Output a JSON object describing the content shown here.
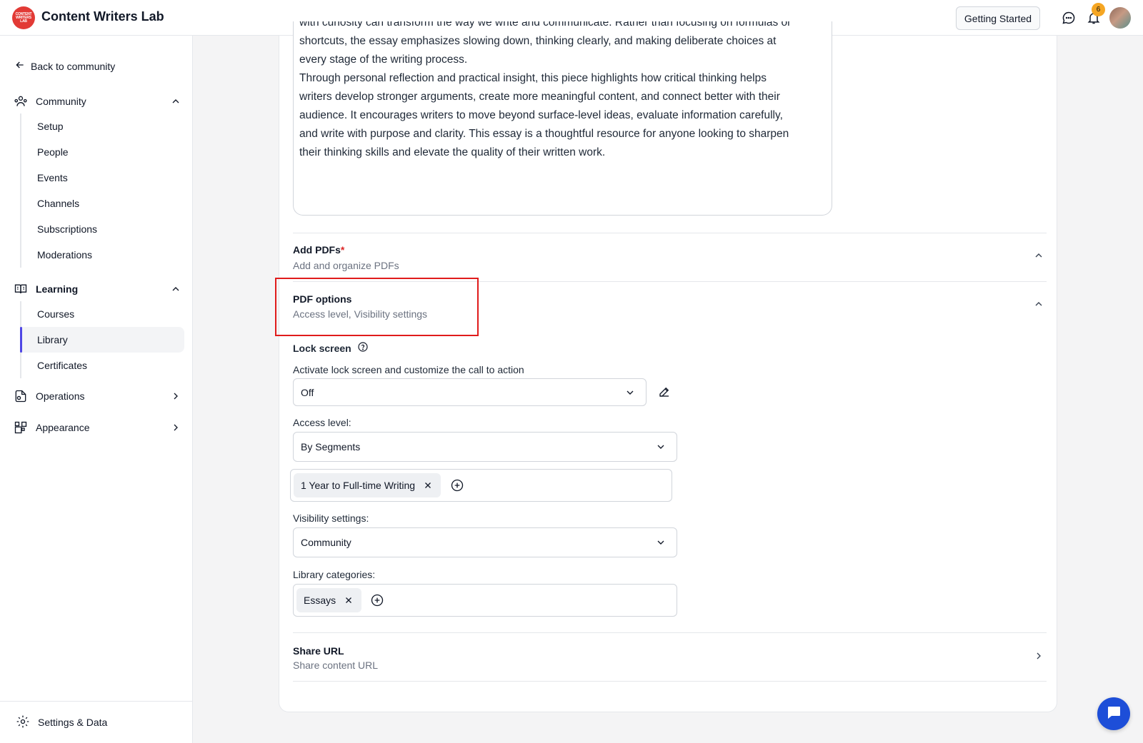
{
  "app": {
    "title": "Content Writers Lab",
    "logo_text": "CONTENT WRITERS LAB"
  },
  "topbar": {
    "getting_started_label": "Getting Started",
    "notification_count": "6"
  },
  "sidebar": {
    "back_label": "Back to community",
    "community": {
      "label": "Community",
      "items": [
        "Setup",
        "People",
        "Events",
        "Channels",
        "Subscriptions",
        "Moderations"
      ]
    },
    "learning": {
      "label": "Learning",
      "items": [
        "Courses",
        "Library",
        "Certificates"
      ],
      "active_item": "Library"
    },
    "operations_label": "Operations",
    "appearance_label": "Appearance",
    "settings_label": "Settings & Data"
  },
  "description": {
    "partial_line": "with curiosity can transform the way we write and communicate. Rather than focusing on formulas or",
    "line_2": "shortcuts, the essay emphasizes slowing down, thinking clearly, and making deliberate choices at",
    "line_3": "every stage of the writing process.",
    "paragraph_2_l1": "Through personal reflection and practical insight, this piece highlights how critical thinking helps",
    "paragraph_2_l2": "writers develop stronger arguments, create more meaningful content, and connect better with their",
    "paragraph_2_l3": "audience. It encourages writers to move beyond surface-level ideas, evaluate information carefully,",
    "paragraph_2_l4": "and write with purpose and clarity. This essay is a thoughtful resource for anyone looking to sharpen",
    "paragraph_2_l5": "their thinking skills and elevate the quality of their written work."
  },
  "add_pdfs": {
    "title": "Add PDFs",
    "required_mark": "*",
    "subtitle": "Add and organize PDFs"
  },
  "pdf_options": {
    "title": "PDF options",
    "subtitle": "Access level, Visibility settings",
    "lock_screen_label": "Lock screen",
    "lock_screen_help": "Activate lock screen and customize the call to action",
    "lock_screen_value": "Off",
    "access_level_label": "Access level:",
    "access_level_value": "By Segments",
    "segment_tags": [
      "1 Year to Full-time Writing"
    ],
    "visibility_label": "Visibility settings:",
    "visibility_value": "Community",
    "library_categories_label": "Library categories:",
    "category_tags": [
      "Essays"
    ]
  },
  "share_url": {
    "title": "Share URL",
    "subtitle": "Share content URL"
  },
  "colors": {
    "accent": "#4f46e5",
    "highlight": "#e01b1b",
    "badge": "#f5a623",
    "chat_button": "#1d4ed8"
  }
}
